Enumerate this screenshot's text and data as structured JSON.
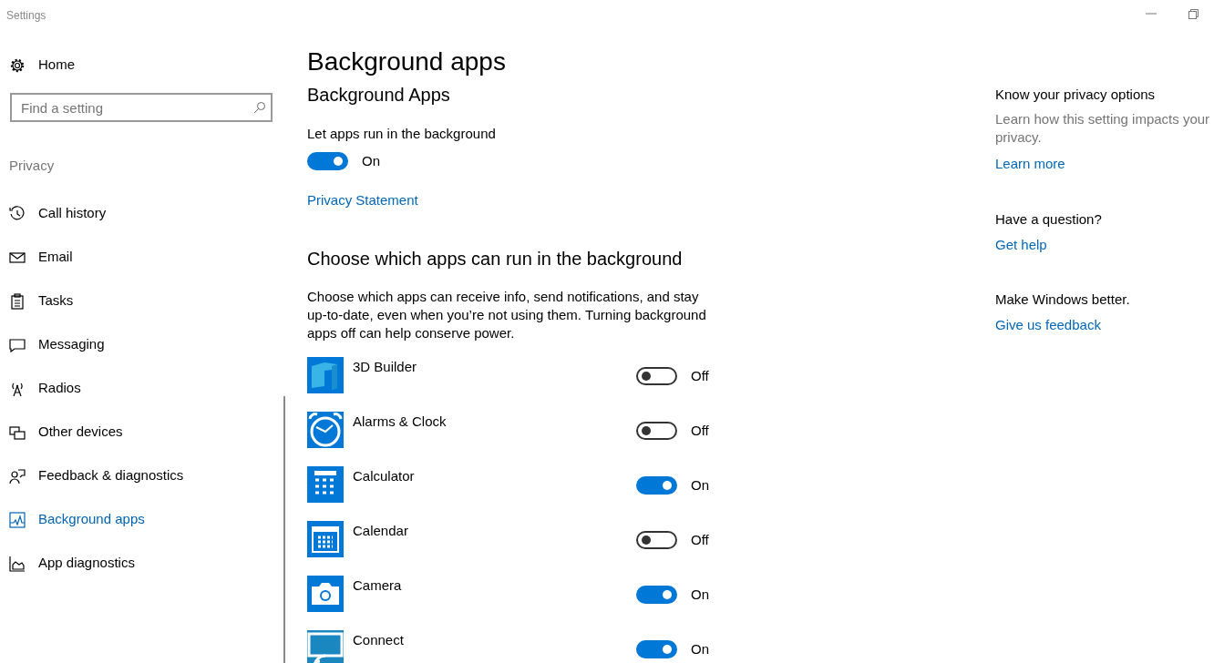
{
  "window": {
    "title": "Settings"
  },
  "sidebar": {
    "home": "Home",
    "search": {
      "placeholder": "Find a setting"
    },
    "section": "Privacy",
    "items": [
      {
        "label": "Call history",
        "selected": false
      },
      {
        "label": "Email",
        "selected": false
      },
      {
        "label": "Tasks",
        "selected": false
      },
      {
        "label": "Messaging",
        "selected": false
      },
      {
        "label": "Radios",
        "selected": false
      },
      {
        "label": "Other devices",
        "selected": false
      },
      {
        "label": "Feedback & diagnostics",
        "selected": false
      },
      {
        "label": "Background apps",
        "selected": true
      },
      {
        "label": "App diagnostics",
        "selected": false
      }
    ]
  },
  "main": {
    "title": "Background apps",
    "subtitle": "Background Apps",
    "master": {
      "label": "Let apps run in the background",
      "on": true,
      "state_text": "On"
    },
    "privacy_link": "Privacy Statement",
    "section_title": "Choose which apps can run in the background",
    "description": "Choose which apps can receive info, send notifications, and stay up-to-date, even when you’re not using them. Turning background apps off can help conserve power.",
    "apps": [
      {
        "name": "3D Builder",
        "on": false,
        "state_text": "Off"
      },
      {
        "name": "Alarms & Clock",
        "on": false,
        "state_text": "Off"
      },
      {
        "name": "Calculator",
        "on": true,
        "state_text": "On"
      },
      {
        "name": "Calendar",
        "on": false,
        "state_text": "Off"
      },
      {
        "name": "Camera",
        "on": true,
        "state_text": "On"
      },
      {
        "name": "Connect",
        "on": true,
        "state_text": "On"
      }
    ]
  },
  "aside": [
    {
      "heading": "Know your privacy options",
      "text": "Learn how this setting impacts your privacy.",
      "link": "Learn more"
    },
    {
      "heading": "Have a question?",
      "link": "Get help"
    },
    {
      "heading": "Make Windows better.",
      "link": "Give us feedback"
    }
  ]
}
